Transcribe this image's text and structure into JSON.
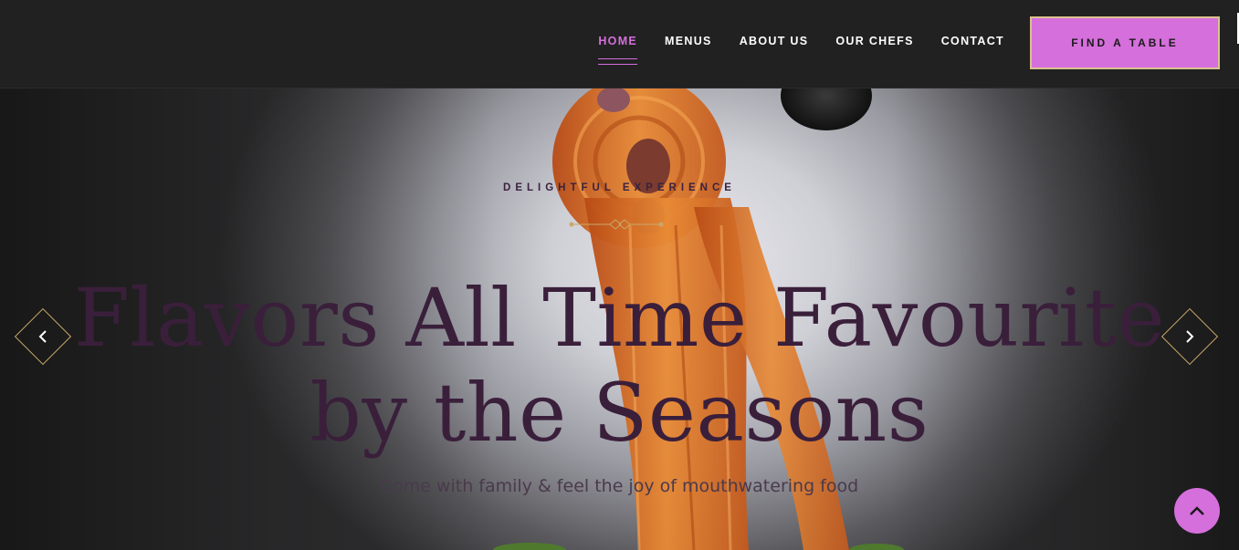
{
  "nav": {
    "items": [
      {
        "label": "HOME",
        "active": true
      },
      {
        "label": "MENUS",
        "active": false
      },
      {
        "label": "ABOUT US",
        "active": false
      },
      {
        "label": "OUR CHEFS",
        "active": false
      },
      {
        "label": "CONTACT",
        "active": false
      }
    ],
    "cta_label": "FIND A TABLE"
  },
  "hero": {
    "eyebrow": "DELIGHTFUL EXPERIENCE",
    "title_line1": "Flavors All Time Favourite",
    "title_line2": "by the Seasons",
    "subtitle": "Come with family & feel the joy of mouthwatering food",
    "prev_icon": "chevron-left-icon",
    "next_icon": "chevron-right-icon"
  },
  "scroll_top_icon": "chevron-up-icon",
  "colors": {
    "accent": "#d56fdc",
    "gold": "#c9a86a",
    "header_bg": "#212121",
    "title_color": "#3a1f3b"
  }
}
